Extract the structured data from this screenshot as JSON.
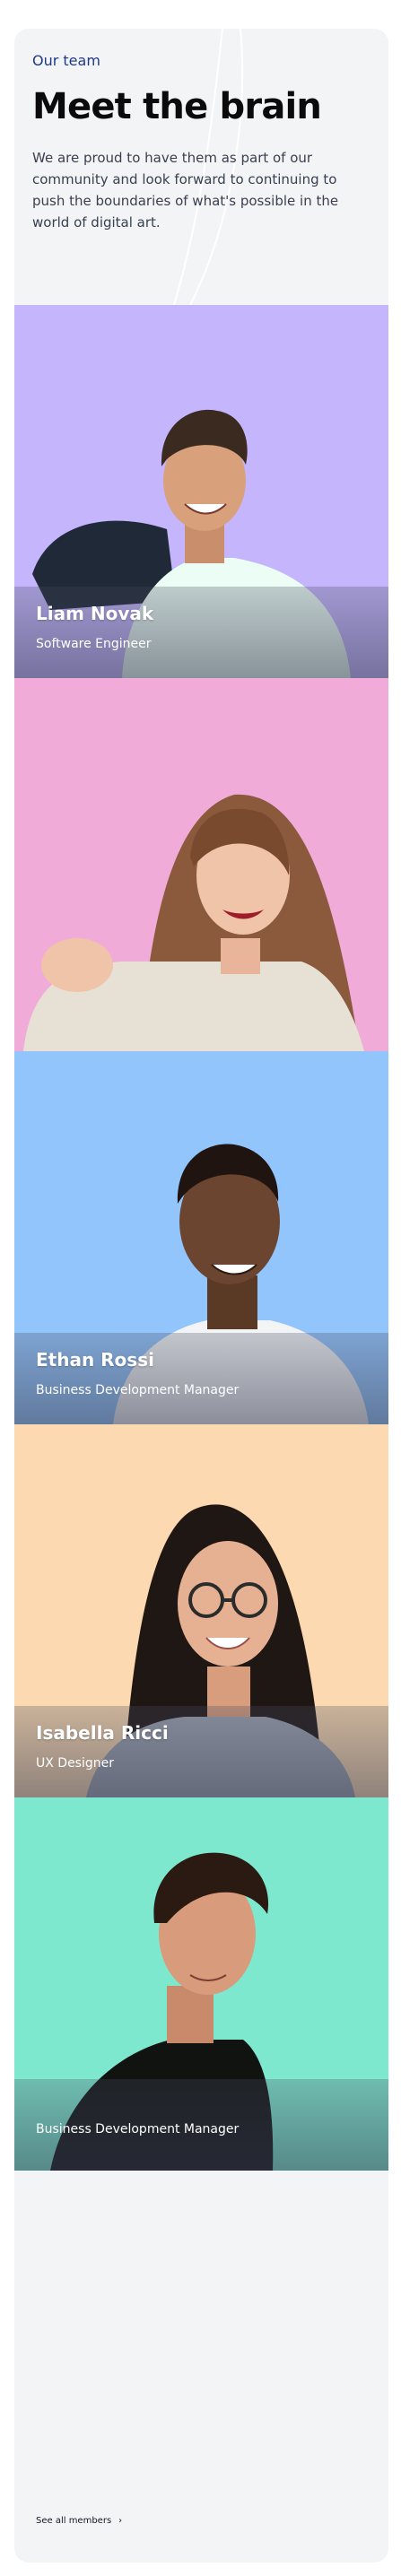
{
  "team": {
    "eyebrow": "Our team",
    "headline": "Meet the brain",
    "lead": "We are proud to have them as part of our community and look forward to continuing to push the boundaries of what's possible in the world of digital art."
  },
  "members": [
    {
      "name": "Liam Novak",
      "role": "Software Engineer",
      "bg": "#c4b5fd"
    },
    {
      "name": "",
      "role": "",
      "bg": "#f0abd8"
    },
    {
      "name": "Ethan Rossi",
      "role": "Business Development Manager",
      "bg": "#93c5fd"
    },
    {
      "name": "Isabella Ricci",
      "role": "UX Designer",
      "bg": "#fcd9b0"
    },
    {
      "name": "",
      "role": "Business Development Manager",
      "bg": "#7ee8cf"
    }
  ],
  "footer": {
    "see_all_label": "See all members",
    "arrow_icon": "arrow-right-icon"
  },
  "colors": {
    "card_bg": "#f3f4f6",
    "eyebrow": "#1e3a8a",
    "headline": "#0b0b0b"
  }
}
